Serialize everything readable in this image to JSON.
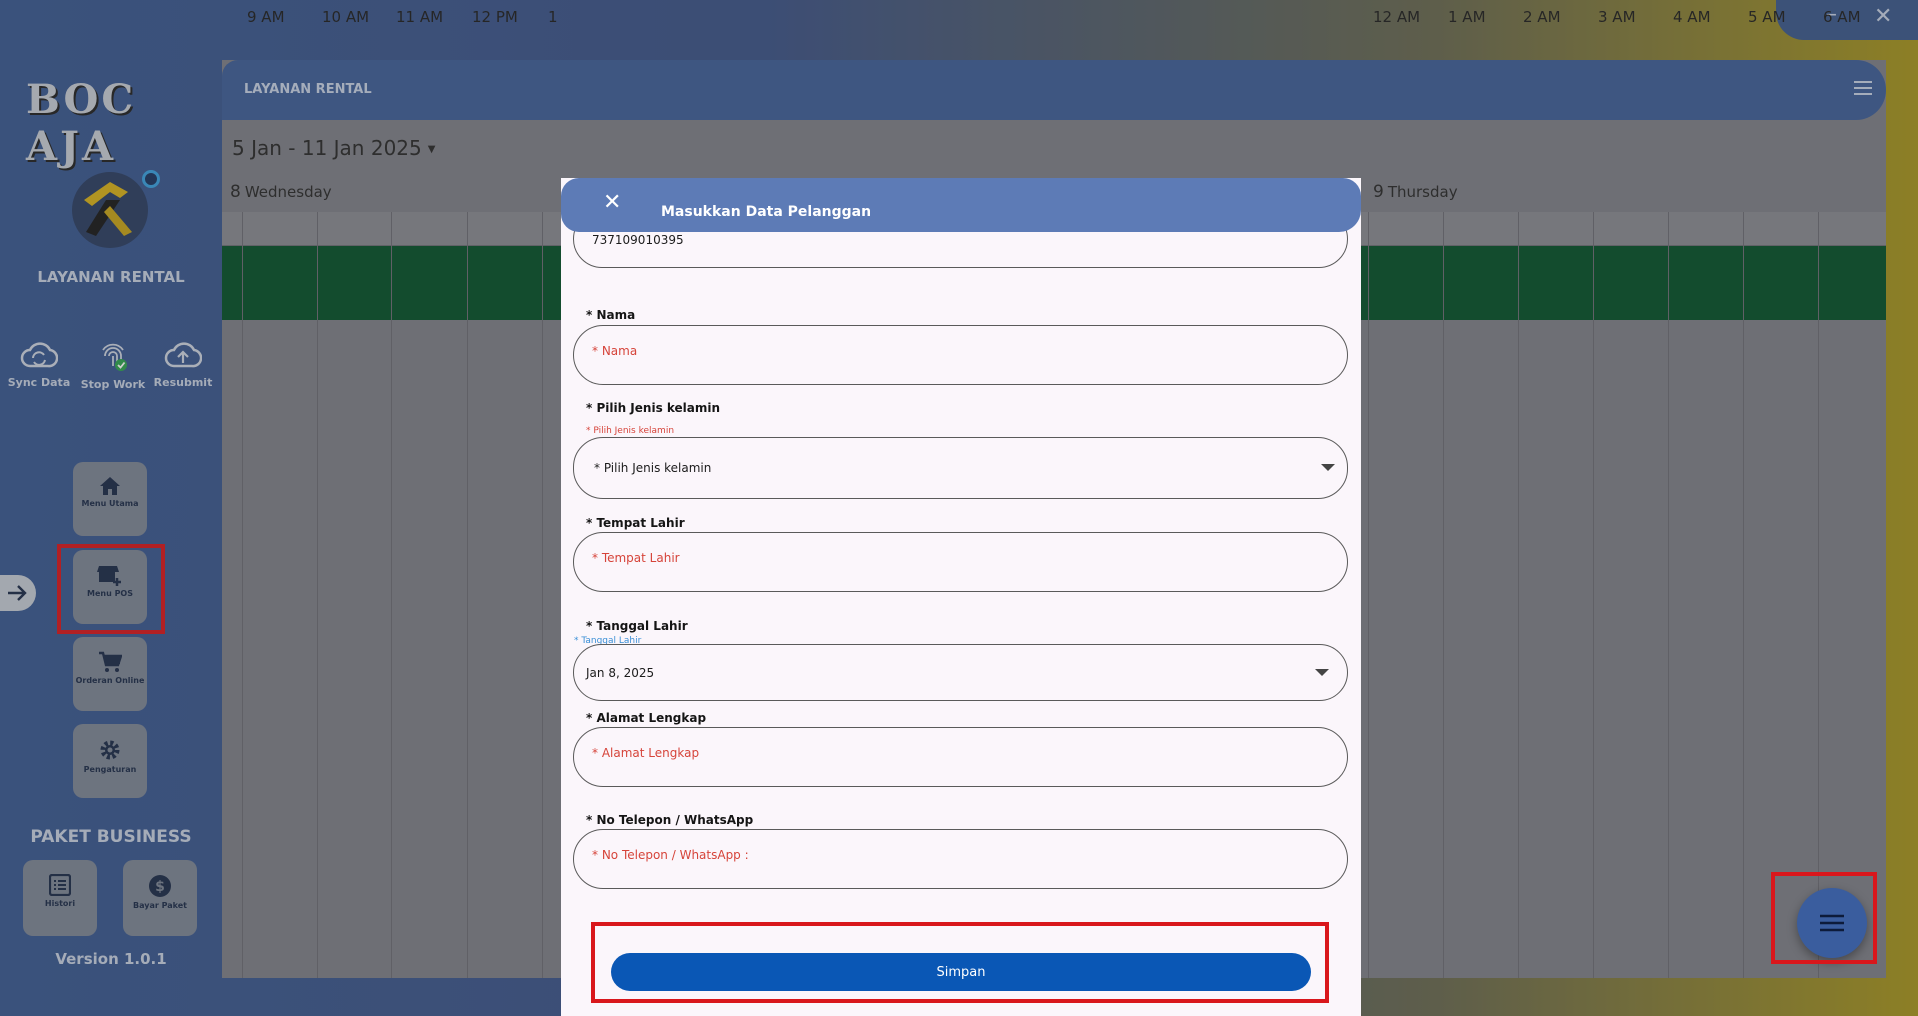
{
  "window": {
    "minimize": "–",
    "close": "✕"
  },
  "sidebar": {
    "logo_text": "BOC AJA",
    "title": "LAYANAN RENTAL",
    "quick_actions": [
      {
        "label": "Sync Data",
        "icon": "cloud-sync-icon"
      },
      {
        "label": "Stop Work",
        "icon": "fingerprint-check-icon"
      },
      {
        "label": "Resubmit",
        "icon": "cloud-upload-icon"
      }
    ],
    "nav": [
      {
        "label": "Menu Utama",
        "icon": "home-icon"
      },
      {
        "label": "Menu POS",
        "icon": "store-add-icon"
      },
      {
        "label": "Orderan Online",
        "icon": "cart-icon"
      },
      {
        "label": "Pengaturan",
        "icon": "gear-icon"
      }
    ],
    "paket": "PAKET BUSINESS",
    "paket_buttons": [
      {
        "label": "Histori",
        "icon": "list-icon"
      },
      {
        "label": "Bayar Paket",
        "icon": "dollar-icon"
      }
    ],
    "version": "Version 1.0.1"
  },
  "header": {
    "title": "LAYANAN RENTAL"
  },
  "calendar": {
    "date_range": "5 Jan - 11 Jan 2025",
    "days": [
      {
        "num": "8",
        "name": "Wednesday"
      },
      {
        "num": "9",
        "name": "Thursday"
      }
    ],
    "hours_left": [
      "9 AM",
      "10 AM",
      "11 AM",
      "12 PM",
      "1"
    ],
    "hours_right": [
      "12 AM",
      "1 AM",
      "2 AM",
      "3 AM",
      "4 AM",
      "5 AM",
      "6 AM"
    ]
  },
  "modal": {
    "title": "Masukkan Data Pelanggan",
    "id_value": "737109010395",
    "nama": {
      "label": "* Nama",
      "placeholder": "* Nama"
    },
    "gender": {
      "label": "* Pilih Jenis kelamin",
      "hint": "* Pilih Jenis kelamin",
      "value": "* Pilih Jenis kelamin"
    },
    "tempat": {
      "label": "* Tempat Lahir",
      "placeholder": "* Tempat Lahir"
    },
    "tanggal": {
      "label": "* Tanggal Lahir",
      "hint": "* Tanggal Lahir",
      "value": "Jan 8, 2025"
    },
    "alamat": {
      "label": "* Alamat Lengkap",
      "placeholder": "* Alamat Lengkap"
    },
    "telepon": {
      "label": "* No Telepon / WhatsApp",
      "placeholder": "* No Telepon / WhatsApp :"
    },
    "save_label": "Simpan"
  },
  "colors": {
    "accent": "#0a57b5",
    "highlight": "#d9171c",
    "header": "#5d7bb6",
    "band": "#06522a"
  }
}
